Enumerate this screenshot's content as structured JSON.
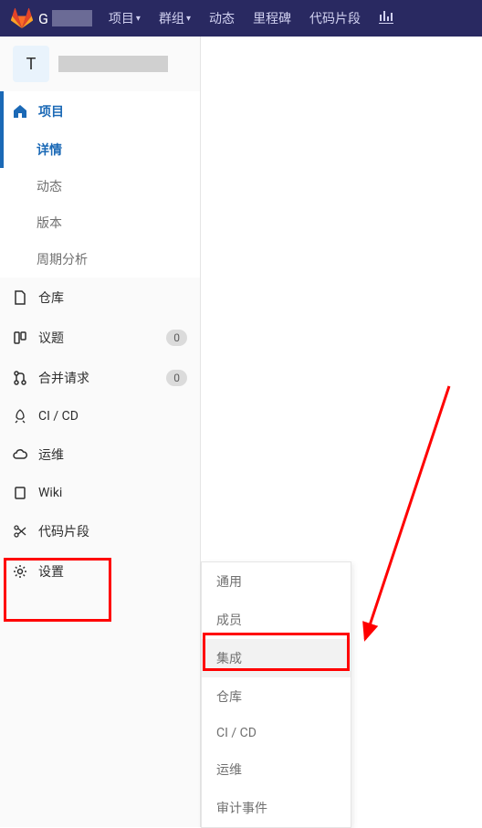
{
  "navbar": {
    "brand_initial": "G",
    "items": [
      {
        "label": "项目",
        "has_caret": true
      },
      {
        "label": "群组",
        "has_caret": true
      },
      {
        "label": "动态",
        "has_caret": false
      },
      {
        "label": "里程碑",
        "has_caret": false
      },
      {
        "label": "代码片段",
        "has_caret": false
      }
    ]
  },
  "project": {
    "avatar_letter": "T"
  },
  "sidebar": {
    "groups": [
      {
        "icon": "home",
        "label": "项目",
        "active": true,
        "sub": [
          {
            "label": "详情",
            "active": true
          },
          {
            "label": "动态",
            "active": false
          },
          {
            "label": "版本",
            "active": false
          },
          {
            "label": "周期分析",
            "active": false
          }
        ]
      },
      {
        "icon": "doc",
        "label": "仓库"
      },
      {
        "icon": "issues",
        "label": "议题",
        "count": "0"
      },
      {
        "icon": "merge",
        "label": "合并请求",
        "count": "0"
      },
      {
        "icon": "rocket",
        "label": "CI / CD"
      },
      {
        "icon": "cloud",
        "label": "运维"
      },
      {
        "icon": "book",
        "label": "Wiki"
      },
      {
        "icon": "scissors",
        "label": "代码片段"
      },
      {
        "icon": "gear",
        "label": "设置"
      }
    ]
  },
  "flyout": {
    "items": [
      {
        "label": "通用"
      },
      {
        "label": "成员"
      },
      {
        "label": "集成",
        "highlight": true
      },
      {
        "label": "仓库"
      },
      {
        "label": "CI / CD"
      },
      {
        "label": "运维"
      },
      {
        "label": "审计事件"
      }
    ]
  }
}
